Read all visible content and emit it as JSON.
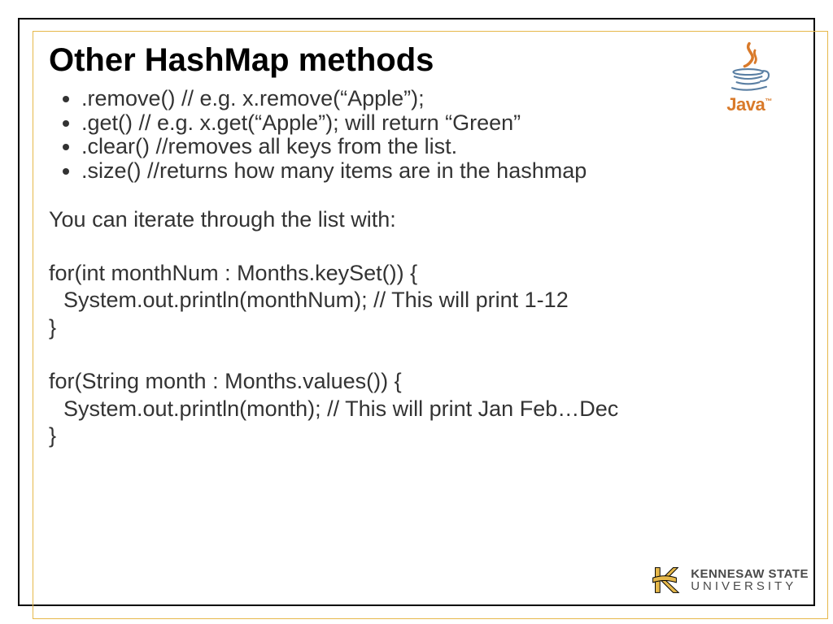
{
  "title": "Other HashMap methods",
  "bullets": [
    ".remove()  // e.g. x.remove(“Apple”);",
    ".get()  // e.g. x.get(“Apple”); will return “Green”",
    ".clear() //removes all keys from the list.",
    ".size() //returns how many items are in the hashmap"
  ],
  "iterate_intro": "You can iterate through the list with:",
  "loop1_line1": "for(int monthNum : Months.keySet()) {",
  "loop1_line2": "System.out.println(monthNum);  // This will print 1-12",
  "loop1_line3": "}",
  "loop2_line1": "for(String month : Months.values()) {",
  "loop2_line2": "System.out.println(month); // This will print Jan Feb…Dec",
  "loop2_line3": "}",
  "java_label": "Java",
  "ksu_line1": "KENNESAW STATE",
  "ksu_line2": "UNIVERSITY"
}
